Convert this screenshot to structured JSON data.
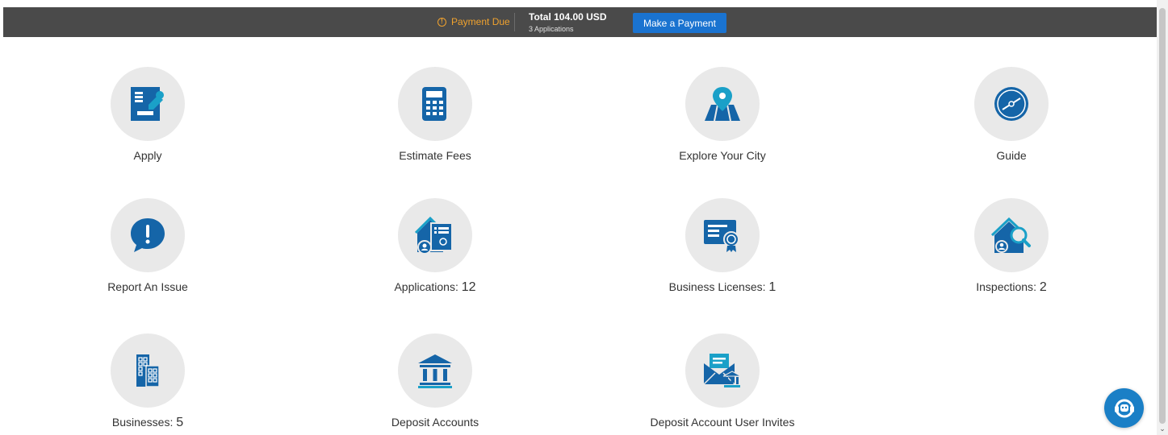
{
  "payment_bar": {
    "status": "Payment Due",
    "total": "Total 104.00 USD",
    "applications": "3 Applications",
    "button_label": "Make a Payment"
  },
  "tiles": [
    {
      "label": "Apply",
      "count": "",
      "icon": "apply-form-icon"
    },
    {
      "label": "Estimate Fees",
      "count": "",
      "icon": "calculator-icon"
    },
    {
      "label": "Explore Your City",
      "count": "",
      "icon": "map-pin-icon"
    },
    {
      "label": "Guide",
      "count": "",
      "icon": "compass-icon"
    },
    {
      "label": "Report An Issue",
      "count": "",
      "icon": "alert-bubble-icon"
    },
    {
      "label": "Applications",
      "count": "12",
      "icon": "house-document-icon"
    },
    {
      "label": "Business Licenses",
      "count": "1",
      "icon": "certificate-icon"
    },
    {
      "label": "Inspections",
      "count": "2",
      "icon": "house-search-icon"
    },
    {
      "label": "Businesses",
      "count": "5",
      "icon": "buildings-icon"
    },
    {
      "label": "Deposit Accounts",
      "count": "",
      "icon": "bank-icon"
    },
    {
      "label": "Deposit Account User Invites",
      "count": "",
      "icon": "envelope-bank-icon"
    }
  ],
  "colors": {
    "bar_bg": "#4a4a4a",
    "warning": "#f0a22e",
    "button": "#1a73d0",
    "icon_blue": "#1565a8",
    "icon_teal": "#1aa0c8",
    "circle_bg": "#e9e9e9",
    "chat": "#1a7fc6"
  },
  "chat": {
    "icon": "support-chat-icon"
  }
}
